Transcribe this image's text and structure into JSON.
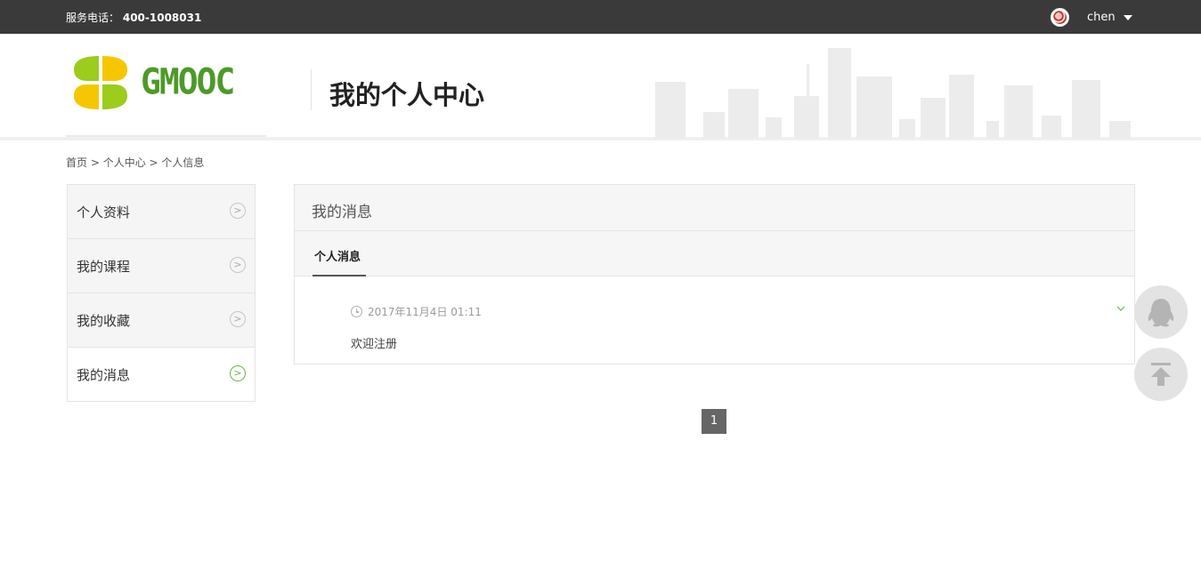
{
  "topbar": {
    "hotline_label": "服务电话：",
    "hotline_number": "400-1008031",
    "username": "chen"
  },
  "header": {
    "logo_text": "GMOOC",
    "page_title": "我的个人中心"
  },
  "breadcrumb": {
    "home": "首页",
    "sep1": " > ",
    "center": "个人中心",
    "sep2": " > ",
    "current": "个人信息"
  },
  "sidebar": {
    "items": [
      {
        "label": "个人资料",
        "active": false
      },
      {
        "label": "我的课程",
        "active": false
      },
      {
        "label": "我的收藏",
        "active": false
      },
      {
        "label": "我的消息",
        "active": true
      }
    ]
  },
  "main": {
    "title": "我的消息",
    "tab": "个人消息",
    "messages": [
      {
        "time": "2017年11月4日 01:11",
        "content": "欢迎注册"
      }
    ]
  },
  "pagination": {
    "current_page": "1"
  },
  "floating": {
    "qq_icon": "qq-penguin-icon",
    "top_icon": "back-to-top-icon"
  },
  "colors": {
    "brand_green": "#4d9a29",
    "logo_yellow": "#f6c700",
    "logo_lime": "#9ccc1c",
    "topbar_bg": "#3a3a3a"
  }
}
